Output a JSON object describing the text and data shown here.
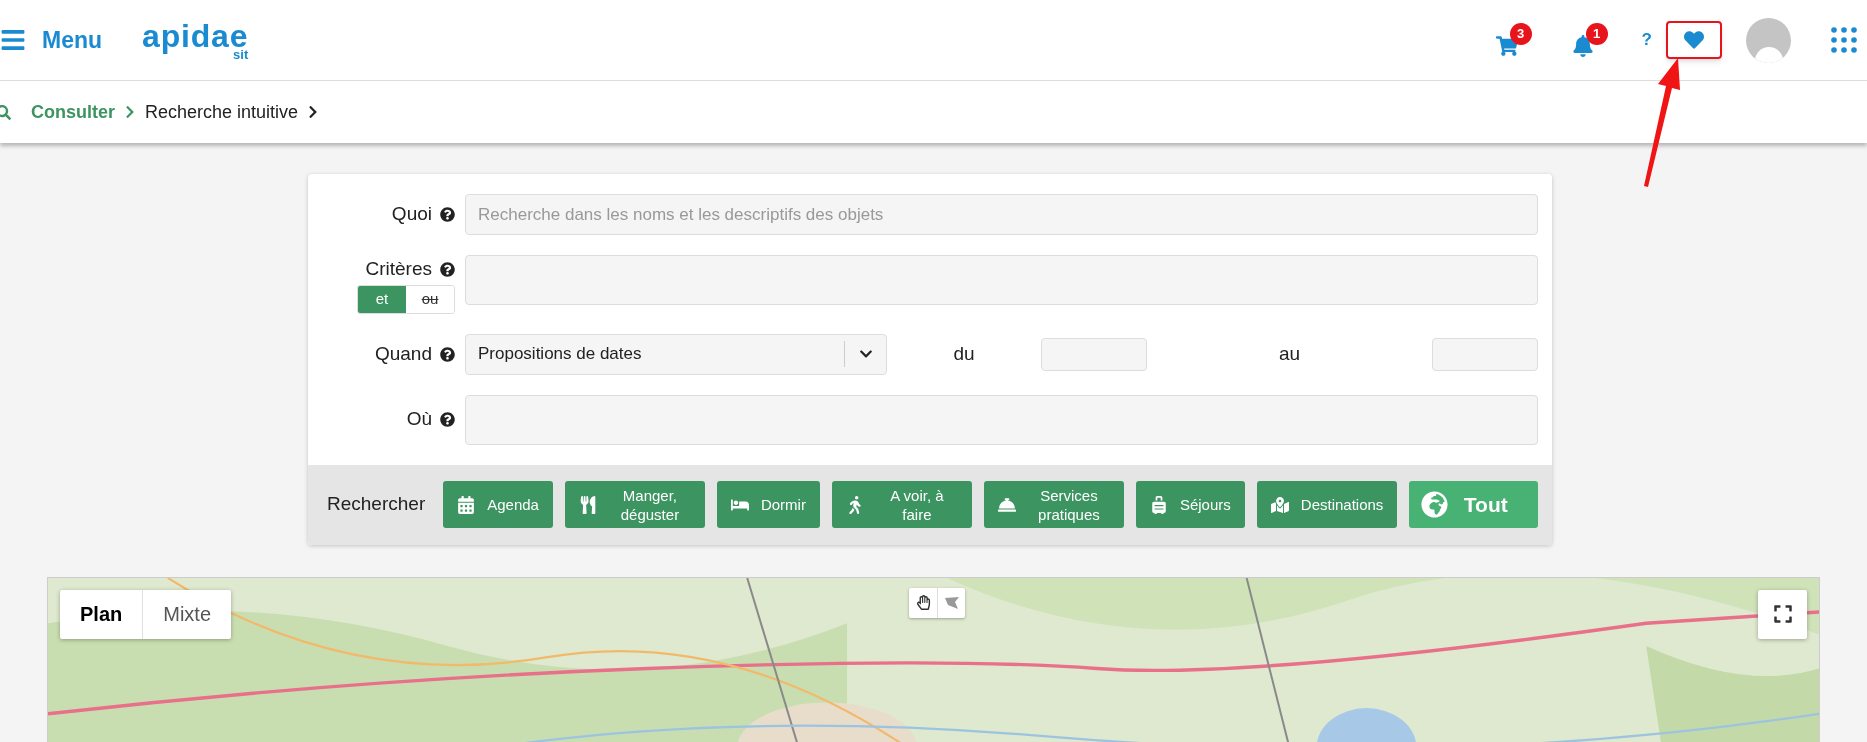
{
  "header": {
    "menu_label": "Menu",
    "logo": {
      "name": "apidae",
      "sub": "sit"
    },
    "cart_badge": "3",
    "notifications_badge": "1",
    "help": "?",
    "favorites_highlighted": true
  },
  "breadcrumb": [
    "Consulter",
    "Recherche intuitive"
  ],
  "form": {
    "quoi": {
      "label": "Quoi",
      "placeholder": "Recherche dans les noms et les descriptifs des objets"
    },
    "criteres": {
      "label": "Critères",
      "options": [
        {
          "label": "et",
          "selected": true
        },
        {
          "label": "ou",
          "selected": false
        }
      ]
    },
    "quand": {
      "label": "Quand",
      "value": "Propositions de dates",
      "from_label": "du",
      "to_label": "au"
    },
    "ou": {
      "label": "Où"
    },
    "search": {
      "label": "Rechercher",
      "buttons": [
        {
          "label": "Agenda",
          "kind": "category"
        },
        {
          "label": "Manger, déguster",
          "kind": "category"
        },
        {
          "label": "Dormir",
          "kind": "category"
        },
        {
          "label": "A voir, à faire",
          "kind": "category"
        },
        {
          "label": "Services pratiques",
          "kind": "category"
        },
        {
          "label": "Séjours",
          "kind": "category"
        },
        {
          "label": "Destinations",
          "kind": "category"
        },
        {
          "label": "Tout",
          "kind": "all"
        }
      ]
    }
  },
  "map": {
    "kind": "picture",
    "tabs": [
      {
        "label": "Plan",
        "selected": true
      },
      {
        "label": "Mixte",
        "selected": false
      }
    ]
  }
}
